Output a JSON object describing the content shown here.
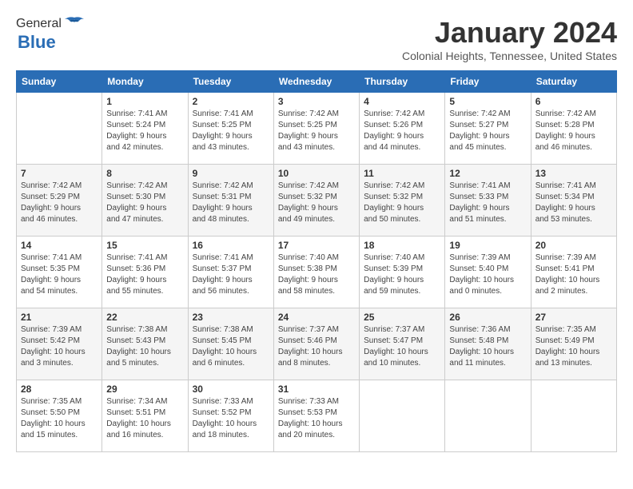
{
  "header": {
    "logo_general": "General",
    "logo_blue": "Blue",
    "month_title": "January 2024",
    "location": "Colonial Heights, Tennessee, United States"
  },
  "days_of_week": [
    "Sunday",
    "Monday",
    "Tuesday",
    "Wednesday",
    "Thursday",
    "Friday",
    "Saturday"
  ],
  "weeks": [
    [
      {
        "day": "",
        "info": ""
      },
      {
        "day": "1",
        "info": "Sunrise: 7:41 AM\nSunset: 5:24 PM\nDaylight: 9 hours\nand 42 minutes."
      },
      {
        "day": "2",
        "info": "Sunrise: 7:41 AM\nSunset: 5:25 PM\nDaylight: 9 hours\nand 43 minutes."
      },
      {
        "day": "3",
        "info": "Sunrise: 7:42 AM\nSunset: 5:25 PM\nDaylight: 9 hours\nand 43 minutes."
      },
      {
        "day": "4",
        "info": "Sunrise: 7:42 AM\nSunset: 5:26 PM\nDaylight: 9 hours\nand 44 minutes."
      },
      {
        "day": "5",
        "info": "Sunrise: 7:42 AM\nSunset: 5:27 PM\nDaylight: 9 hours\nand 45 minutes."
      },
      {
        "day": "6",
        "info": "Sunrise: 7:42 AM\nSunset: 5:28 PM\nDaylight: 9 hours\nand 46 minutes."
      }
    ],
    [
      {
        "day": "7",
        "info": "Sunrise: 7:42 AM\nSunset: 5:29 PM\nDaylight: 9 hours\nand 46 minutes."
      },
      {
        "day": "8",
        "info": "Sunrise: 7:42 AM\nSunset: 5:30 PM\nDaylight: 9 hours\nand 47 minutes."
      },
      {
        "day": "9",
        "info": "Sunrise: 7:42 AM\nSunset: 5:31 PM\nDaylight: 9 hours\nand 48 minutes."
      },
      {
        "day": "10",
        "info": "Sunrise: 7:42 AM\nSunset: 5:32 PM\nDaylight: 9 hours\nand 49 minutes."
      },
      {
        "day": "11",
        "info": "Sunrise: 7:42 AM\nSunset: 5:32 PM\nDaylight: 9 hours\nand 50 minutes."
      },
      {
        "day": "12",
        "info": "Sunrise: 7:41 AM\nSunset: 5:33 PM\nDaylight: 9 hours\nand 51 minutes."
      },
      {
        "day": "13",
        "info": "Sunrise: 7:41 AM\nSunset: 5:34 PM\nDaylight: 9 hours\nand 53 minutes."
      }
    ],
    [
      {
        "day": "14",
        "info": "Sunrise: 7:41 AM\nSunset: 5:35 PM\nDaylight: 9 hours\nand 54 minutes."
      },
      {
        "day": "15",
        "info": "Sunrise: 7:41 AM\nSunset: 5:36 PM\nDaylight: 9 hours\nand 55 minutes."
      },
      {
        "day": "16",
        "info": "Sunrise: 7:41 AM\nSunset: 5:37 PM\nDaylight: 9 hours\nand 56 minutes."
      },
      {
        "day": "17",
        "info": "Sunrise: 7:40 AM\nSunset: 5:38 PM\nDaylight: 9 hours\nand 58 minutes."
      },
      {
        "day": "18",
        "info": "Sunrise: 7:40 AM\nSunset: 5:39 PM\nDaylight: 9 hours\nand 59 minutes."
      },
      {
        "day": "19",
        "info": "Sunrise: 7:39 AM\nSunset: 5:40 PM\nDaylight: 10 hours\nand 0 minutes."
      },
      {
        "day": "20",
        "info": "Sunrise: 7:39 AM\nSunset: 5:41 PM\nDaylight: 10 hours\nand 2 minutes."
      }
    ],
    [
      {
        "day": "21",
        "info": "Sunrise: 7:39 AM\nSunset: 5:42 PM\nDaylight: 10 hours\nand 3 minutes."
      },
      {
        "day": "22",
        "info": "Sunrise: 7:38 AM\nSunset: 5:43 PM\nDaylight: 10 hours\nand 5 minutes."
      },
      {
        "day": "23",
        "info": "Sunrise: 7:38 AM\nSunset: 5:45 PM\nDaylight: 10 hours\nand 6 minutes."
      },
      {
        "day": "24",
        "info": "Sunrise: 7:37 AM\nSunset: 5:46 PM\nDaylight: 10 hours\nand 8 minutes."
      },
      {
        "day": "25",
        "info": "Sunrise: 7:37 AM\nSunset: 5:47 PM\nDaylight: 10 hours\nand 10 minutes."
      },
      {
        "day": "26",
        "info": "Sunrise: 7:36 AM\nSunset: 5:48 PM\nDaylight: 10 hours\nand 11 minutes."
      },
      {
        "day": "27",
        "info": "Sunrise: 7:35 AM\nSunset: 5:49 PM\nDaylight: 10 hours\nand 13 minutes."
      }
    ],
    [
      {
        "day": "28",
        "info": "Sunrise: 7:35 AM\nSunset: 5:50 PM\nDaylight: 10 hours\nand 15 minutes."
      },
      {
        "day": "29",
        "info": "Sunrise: 7:34 AM\nSunset: 5:51 PM\nDaylight: 10 hours\nand 16 minutes."
      },
      {
        "day": "30",
        "info": "Sunrise: 7:33 AM\nSunset: 5:52 PM\nDaylight: 10 hours\nand 18 minutes."
      },
      {
        "day": "31",
        "info": "Sunrise: 7:33 AM\nSunset: 5:53 PM\nDaylight: 10 hours\nand 20 minutes."
      },
      {
        "day": "",
        "info": ""
      },
      {
        "day": "",
        "info": ""
      },
      {
        "day": "",
        "info": ""
      }
    ]
  ]
}
